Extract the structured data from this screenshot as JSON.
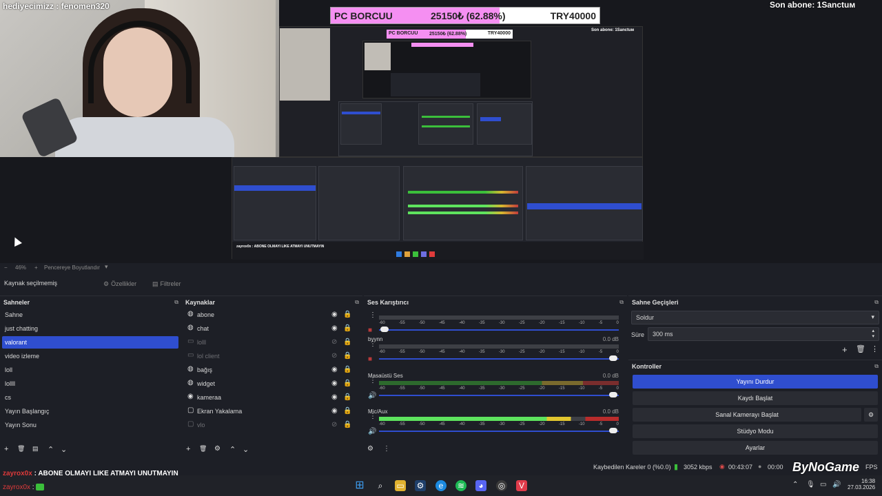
{
  "overlay": {
    "cam_text": "hediyecimizz : fenomen320",
    "goal_name": "PC BORCUU",
    "goal_amount": "25150₺ (62.88%)",
    "goal_target": "TRY40000",
    "goal_progress": 0.6288,
    "sub_text": "Son abone: 1Sanctuм",
    "nested_goal_name": "PC BORCUU",
    "nested_goal_amount": "25150₺ (62.88%)",
    "nested_goal_target": "TRY40000",
    "nested_sub": "Son abone: 1Sanctuм",
    "nested_chat": "zayrox0x : ABONE OLMAYI LIKE ATMAYI UNUTMAYIN"
  },
  "zoom": {
    "percent": "46%",
    "mode": "Pencereye Boyutlandır"
  },
  "source_bar": {
    "label": "Kaynak seçilmemiş",
    "properties": "Özellikler",
    "filters": "Filtreler"
  },
  "scenes": {
    "title": "Sahneler",
    "items": [
      "Sahne",
      "just chatting",
      "valorant",
      "video izleme",
      "loll",
      "lollll",
      "cs",
      "Yayın Başlangıç",
      "Yayın Sonu"
    ],
    "selected_index": 2
  },
  "sources": {
    "title": "Kaynaklar",
    "items": [
      {
        "name": "abone",
        "icon": "globe-icon",
        "visible": true
      },
      {
        "name": "chat",
        "icon": "globe-icon",
        "visible": true
      },
      {
        "name": "lolll",
        "icon": "window-icon",
        "visible": false
      },
      {
        "name": "lol client",
        "icon": "window-icon",
        "visible": false
      },
      {
        "name": "bağış",
        "icon": "globe-icon",
        "visible": true
      },
      {
        "name": "widget",
        "icon": "globe-icon",
        "visible": true
      },
      {
        "name": "kameraa",
        "icon": "camera-icon",
        "visible": true
      },
      {
        "name": "Ekran Yakalama",
        "icon": "monitor-icon",
        "visible": true
      },
      {
        "name": "vlo",
        "icon": "monitor-icon",
        "visible": false
      }
    ]
  },
  "mixer": {
    "title": "Ses Karıştırıcı",
    "ticks": [
      "-60",
      "-55",
      "-50",
      "-45",
      "-40",
      "-35",
      "-30",
      "-25",
      "-20",
      "-15",
      "-10",
      "-5",
      "0"
    ],
    "channels": [
      {
        "name": "",
        "db": "",
        "level": 0.0
      },
      {
        "name": "byynn",
        "db": "0.0 dB",
        "level": 0.0
      },
      {
        "name": "Masaüstü Ses",
        "db": "0.0 dB",
        "level": 0.0
      },
      {
        "name": "Mic/Aux",
        "db": "0.0 dB",
        "level": 0.8
      }
    ]
  },
  "transitions": {
    "title": "Sahne Geçişleri",
    "type": "Soldur",
    "duration_label": "Süre",
    "duration": "300 ms"
  },
  "controls": {
    "title": "Kontroller",
    "stop_stream": "Yayını Durdur",
    "start_record": "Kaydı Başlat",
    "virtual_cam": "Sanal Kamerayı Başlat",
    "studio_mode": "Stüdyo Modu",
    "settings": "Ayarlar"
  },
  "status": {
    "dropped": "Kaybedilen Kareler 0 (%0.0)",
    "bitrate": "3052 kbps",
    "time": "00:43:07",
    "rec_time": "00:00",
    "fps": "FPS"
  },
  "chat": {
    "line1_user": "zayrox0x",
    "line1_msg": ": ABONE OLMAYI LIKE ATMAYI UNUTMAYIN",
    "line2_user": "zayrox0x",
    "line2_msg": ":"
  },
  "taskbar": {
    "time": "16:38",
    "date": "27.03.2026"
  },
  "watermark": "ByNoGame"
}
